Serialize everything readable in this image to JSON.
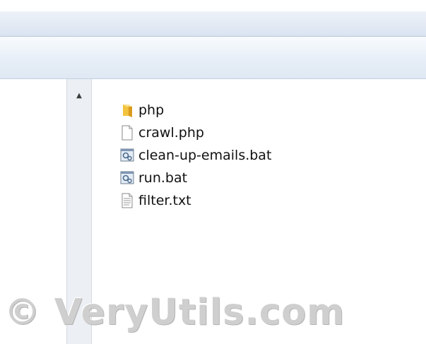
{
  "navigation": {
    "scroll_up_glyph": "▲"
  },
  "file_list": {
    "items": [
      {
        "name": "php",
        "icon": "folder-icon"
      },
      {
        "name": "crawl.php",
        "icon": "blank-file-icon"
      },
      {
        "name": "clean-up-emails.bat",
        "icon": "batch-file-icon"
      },
      {
        "name": "run.bat",
        "icon": "batch-file-icon"
      },
      {
        "name": "filter.txt",
        "icon": "text-file-icon"
      }
    ]
  },
  "watermark": {
    "text": "© VeryUtils.com"
  },
  "colors": {
    "toolbar_top": "#f8fbfe",
    "toolbar_bottom": "#dfe8f3",
    "folder_yellow": "#f2c33d",
    "watermark_gray": "#cfcfcf"
  }
}
